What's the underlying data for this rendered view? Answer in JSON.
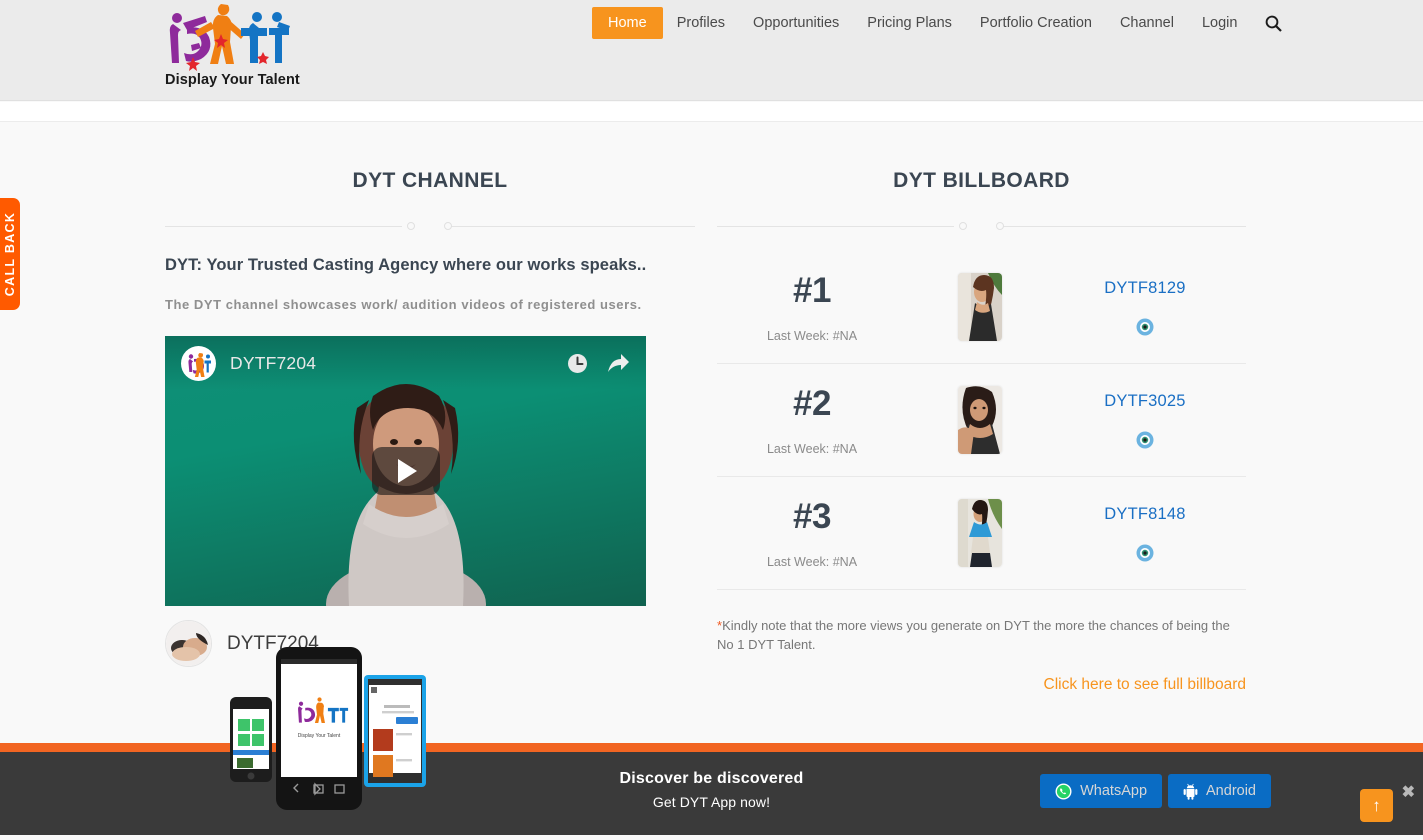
{
  "header": {
    "logo": {
      "alt": "dyt-logo",
      "tagline": "Display Your Talent"
    },
    "nav": [
      {
        "label": "Home",
        "active": true
      },
      {
        "label": "Profiles",
        "active": false
      },
      {
        "label": "Opportunities",
        "active": false
      },
      {
        "label": "Pricing Plans",
        "active": false
      },
      {
        "label": "Portfolio Creation",
        "active": false
      },
      {
        "label": "Channel",
        "active": false
      },
      {
        "label": "Login",
        "active": false
      }
    ],
    "search_icon": "search-icon"
  },
  "callback_tab": {
    "label": "CALL BACK"
  },
  "channel": {
    "title": "DYT CHANNEL",
    "lead": "DYT: Your Trusted Casting Agency where our works speaks..",
    "sub": "The DYT channel showcases work/ audition videos of registered users.",
    "player": {
      "video_title": "DYTF7204",
      "watch_later_icon": "clock-icon",
      "share_icon": "share-icon",
      "play_icon": "play-icon"
    },
    "footer_channel_name": "DYTF7204"
  },
  "billboard": {
    "title": "DYT BILLBOARD",
    "rows": [
      {
        "rank": "#1",
        "last_week": "Last Week: #NA",
        "id": "DYTF8129",
        "views_icon": "eye-icon"
      },
      {
        "rank": "#2",
        "last_week": "Last Week: #NA",
        "id": "DYTF3025",
        "views_icon": "eye-icon"
      },
      {
        "rank": "#3",
        "last_week": "Last Week: #NA",
        "id": "DYTF8148",
        "views_icon": "eye-icon"
      }
    ],
    "note_star": "*",
    "note": "Kindly note that the more views you generate on DYT the more the chances of being the No 1 DYT Talent.",
    "full_link": "Click here to see full billboard"
  },
  "footer": {
    "headline": "Discover be discovered",
    "subline": "Get DYT App now!",
    "whatsapp_label": "WhatsApp",
    "android_label": "Android",
    "whatsapp_icon": "whatsapp-icon",
    "android_icon": "android-icon",
    "to_top_icon": "arrow-up-icon",
    "close_icon": "close-icon"
  },
  "colors": {
    "accent_orange": "#f7941e",
    "callback_orange": "#ff5a00",
    "bar_orange": "#f26522",
    "link_blue": "#1a6fc4",
    "button_blue": "#0a6cc4",
    "footer_dark": "#3a3a3a",
    "heading": "#3b4652",
    "page_bg": "#f9f9f9",
    "header_bg": "#ebebeb"
  }
}
